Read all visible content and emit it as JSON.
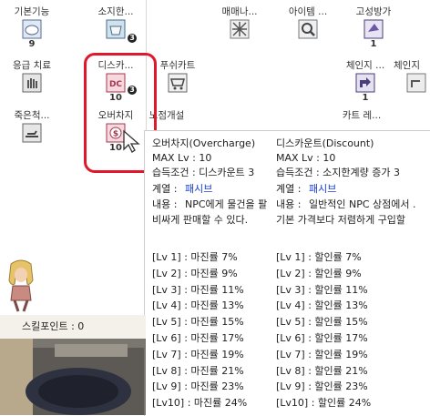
{
  "skills": [
    {
      "name": "기본기능",
      "level": "9",
      "icon": "cloud-icon"
    },
    {
      "name": "소지한...",
      "level": "3",
      "icon": "box-icon"
    },
    {
      "name": "매매나...",
      "level": "",
      "icon": "grid-icon"
    },
    {
      "name": "아이템 ...",
      "level": "",
      "icon": "magnifier-icon"
    },
    {
      "name": "고성방가",
      "level": "1",
      "icon": "shout-icon"
    },
    {
      "name": "응급 치료",
      "level": "",
      "icon": "hand-icon"
    },
    {
      "name": "디스카...",
      "level": "10",
      "icon": "discount-icon"
    },
    {
      "name": "푸쉬카트",
      "level": "",
      "icon": "cart-icon"
    },
    {
      "name": "체인지 ...",
      "level": "1",
      "icon": "change-icon"
    },
    {
      "name": "체인지",
      "level": "",
      "icon": "change2-icon"
    },
    {
      "name": "죽은척...",
      "level": "",
      "icon": "play-dead-icon"
    },
    {
      "name": "오버차지",
      "level": "10",
      "icon": "overcharge-icon"
    },
    {
      "name": "노점개설",
      "level": "",
      "icon": "vending-icon"
    },
    {
      "name": "카트 레...",
      "level": "",
      "icon": "cart-rev-icon"
    }
  ],
  "badges": {
    "box": "3",
    "discount": "3"
  },
  "status": {
    "label": "스킬포인트 : 0"
  },
  "tooltip": {
    "left": {
      "title": "오버차지(Overcharge)",
      "max": "MAX Lv : 10",
      "req": "습득조건 : 디스카운트 3",
      "type_label": "계열 :",
      "type_value": "패시브",
      "desc_label": "내용 :",
      "desc_value": "NPC에게 물건을 팔",
      "desc2": "비싸게 판매할 수 있다.",
      "levels": [
        "[Lv 1] : 마진률 7%",
        "[Lv 2] : 마진률 9%",
        "[Lv 3] : 마진률 11%",
        "[Lv 4] : 마진률 13%",
        "[Lv 5] : 마진률 15%",
        "[Lv 6] : 마진률 17%",
        "[Lv 7] : 마진률 19%",
        "[Lv 8] : 마진률 21%",
        "[Lv 9] : 마진률 23%",
        "[Lv10] : 마진률 24%"
      ]
    },
    "right": {
      "title": "디스카운트(Discount)",
      "max": "MAX Lv : 10",
      "req": "습득조건 : 소지한계량 증가 3",
      "type_label": "계열 :",
      "type_value": "패시브",
      "desc_label": "내용 :",
      "desc_value": "일반적인 NPC 상점에서 .",
      "desc2": "기본 가격보다 저렴하게 구입할",
      "levels": [
        "[Lv 1] : 할인률 7%",
        "[Lv 2] : 할인률 9%",
        "[Lv 3] : 할인률 11%",
        "[Lv 4] : 할인률 13%",
        "[Lv 5] : 할인률 15%",
        "[Lv 6] : 할인률 17%",
        "[Lv 7] : 할인률 19%",
        "[Lv 8] : 할인률 21%",
        "[Lv 9] : 할인률 23%",
        "[Lv10] : 할인률 24%"
      ]
    }
  },
  "colors": {
    "highlight": "#e0182b",
    "link": "#1a3fd0"
  }
}
